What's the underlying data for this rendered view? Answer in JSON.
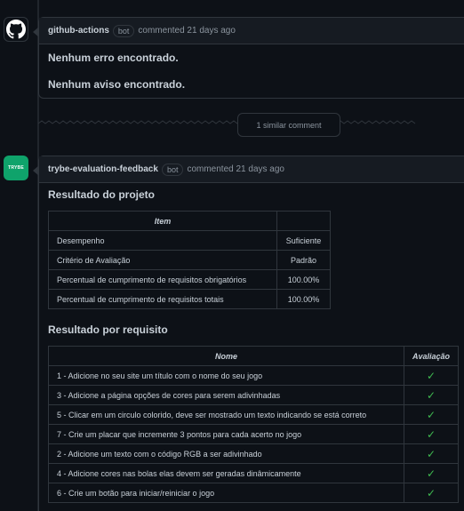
{
  "comment1": {
    "author": "github-actions",
    "badge": "bot",
    "meta": "commented 21 days ago",
    "lines": [
      "Nenhum erro encontrado.",
      "Nenhum aviso encontrado."
    ]
  },
  "similar": {
    "label": "1 similar comment"
  },
  "comment2": {
    "author": "trybe-evaluation-feedback",
    "badge": "bot",
    "meta": "commented 21 days ago",
    "avatar_text": "TRYBE",
    "section1_title": "Resultado do projeto",
    "table1": {
      "headers": [
        "Item",
        ""
      ],
      "rows": [
        [
          "Desempenho",
          "Suficiente"
        ],
        [
          "Critério de Avaliação",
          "Padrão"
        ],
        [
          "Percentual de cumprimento de requisitos obrigatórios",
          "100.00%"
        ],
        [
          "Percentual de cumprimento de requisitos totais",
          "100.00%"
        ]
      ]
    },
    "section2_title": "Resultado por requisito",
    "table2": {
      "headers": [
        "Nome",
        "Avaliação"
      ],
      "rows": [
        [
          "1 - Adicione no seu site um título com o nome do seu jogo",
          "✓"
        ],
        [
          "3 - Adicione a página opções de cores para serem adivinhadas",
          "✓"
        ],
        [
          "5 - Clicar em um circulo colorido, deve ser mostrado um texto indicando se está correto",
          "✓"
        ],
        [
          "7 - Crie um placar que incremente 3 pontos para cada acerto no jogo",
          "✓"
        ],
        [
          "2 - Adicione um texto com o código RGB a ser adivinhado",
          "✓"
        ],
        [
          "4 - Adicione cores nas bolas elas devem ser geradas dinâmicamente",
          "✓"
        ],
        [
          "6 - Crie um botão para iniciar/reiniciar o jogo",
          "✓"
        ]
      ]
    }
  },
  "colors": {
    "background": "#0d1117",
    "border": "#30363d",
    "check": "#3fb950",
    "trybe": "#0fa36b"
  },
  "icons": {
    "github": "github-octocat-icon",
    "check": "check-icon"
  }
}
